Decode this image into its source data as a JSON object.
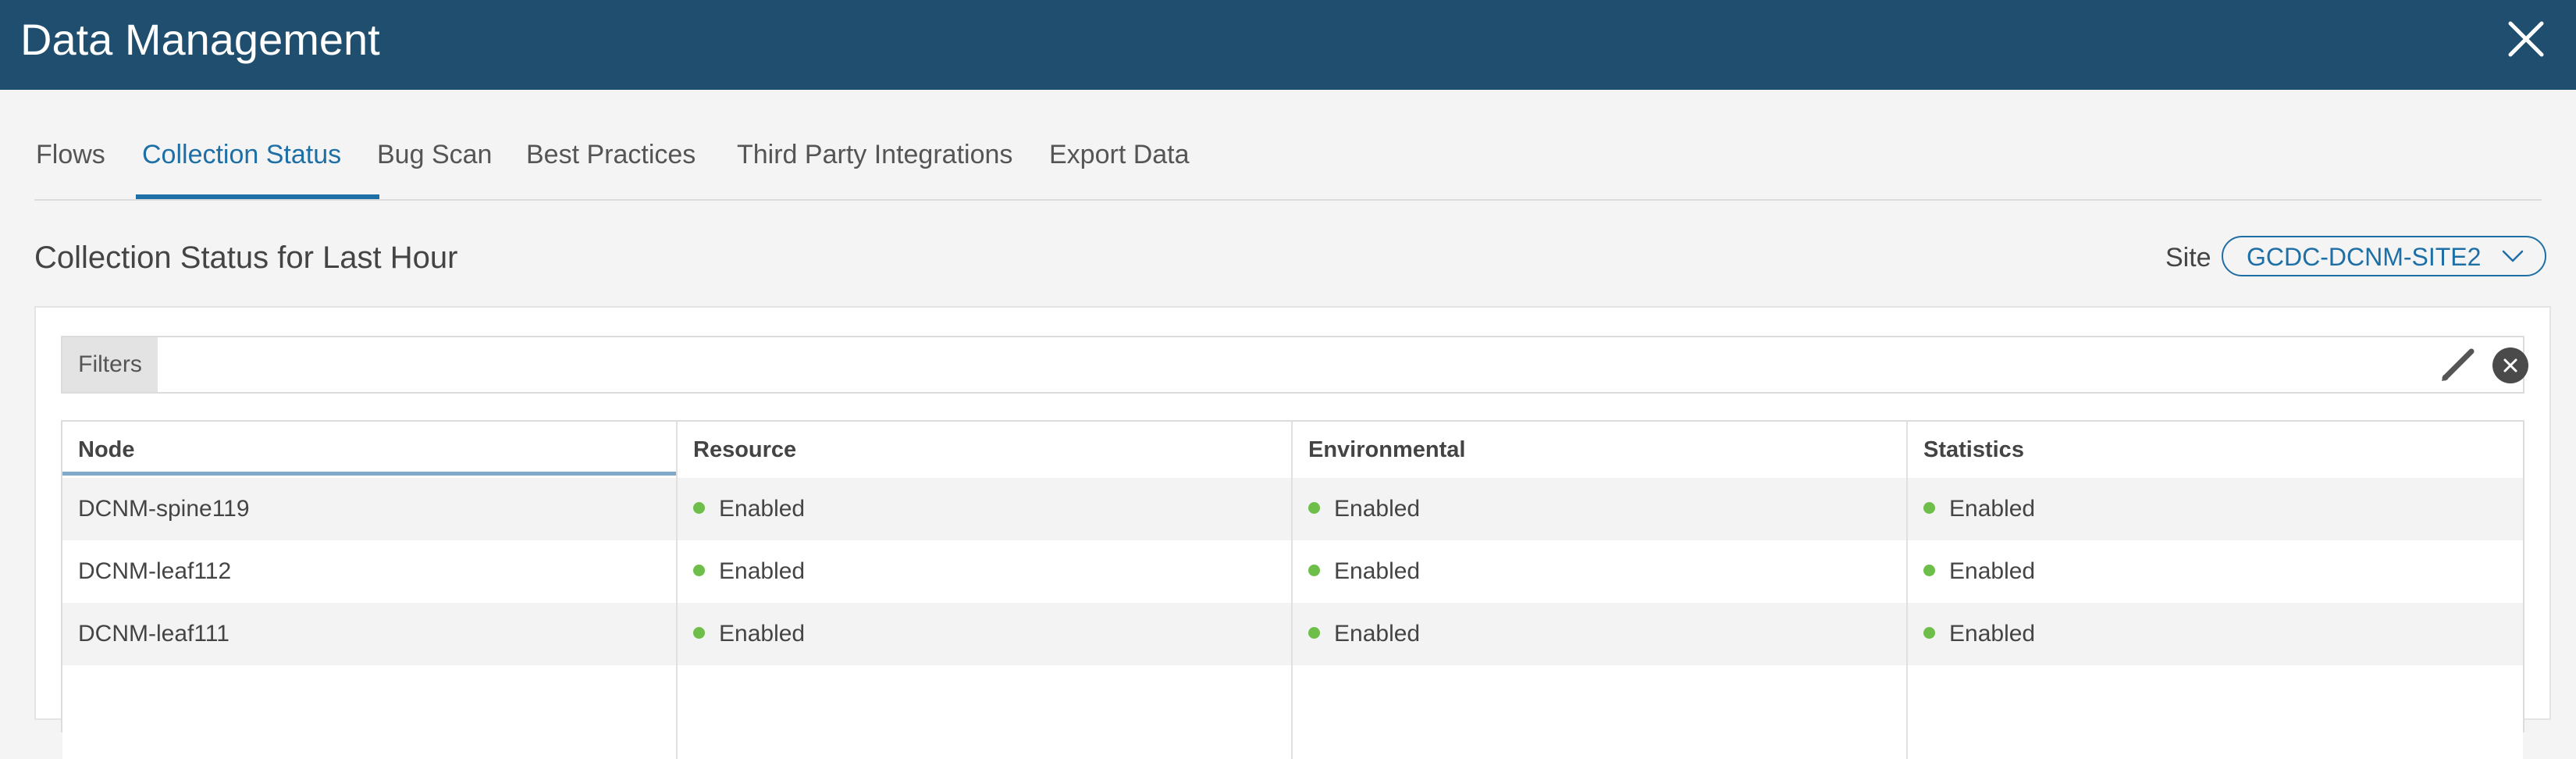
{
  "header": {
    "title": "Data Management",
    "close_icon": "close-icon"
  },
  "tabs": [
    {
      "label": "Flows",
      "active": false
    },
    {
      "label": "Collection Status",
      "active": true
    },
    {
      "label": "Bug Scan",
      "active": false
    },
    {
      "label": "Best Practices",
      "active": false
    },
    {
      "label": "Third Party Integrations",
      "active": false
    },
    {
      "label": "Export Data",
      "active": false
    }
  ],
  "section": {
    "title": "Collection Status for Last Hour"
  },
  "site": {
    "label": "Site",
    "value": "GCDC-DCNM-SITE2"
  },
  "filters": {
    "label": "Filters",
    "value": "",
    "edit_icon": "pencil-icon",
    "clear_icon": "clear-circle-icon"
  },
  "table": {
    "columns": [
      "Node",
      "Resource",
      "Environmental",
      "Statistics"
    ],
    "sorted_column": "Node",
    "rows": [
      {
        "node": "DCNM-spine119",
        "resource": "Enabled",
        "environmental": "Enabled",
        "statistics": "Enabled"
      },
      {
        "node": "DCNM-leaf112",
        "resource": "Enabled",
        "environmental": "Enabled",
        "statistics": "Enabled"
      },
      {
        "node": "DCNM-leaf111",
        "resource": "Enabled",
        "environmental": "Enabled",
        "statistics": "Enabled"
      }
    ]
  },
  "colors": {
    "header_bg": "#1f4e6e",
    "accent": "#1d6fa5",
    "status_enabled": "#6ebe4a"
  }
}
